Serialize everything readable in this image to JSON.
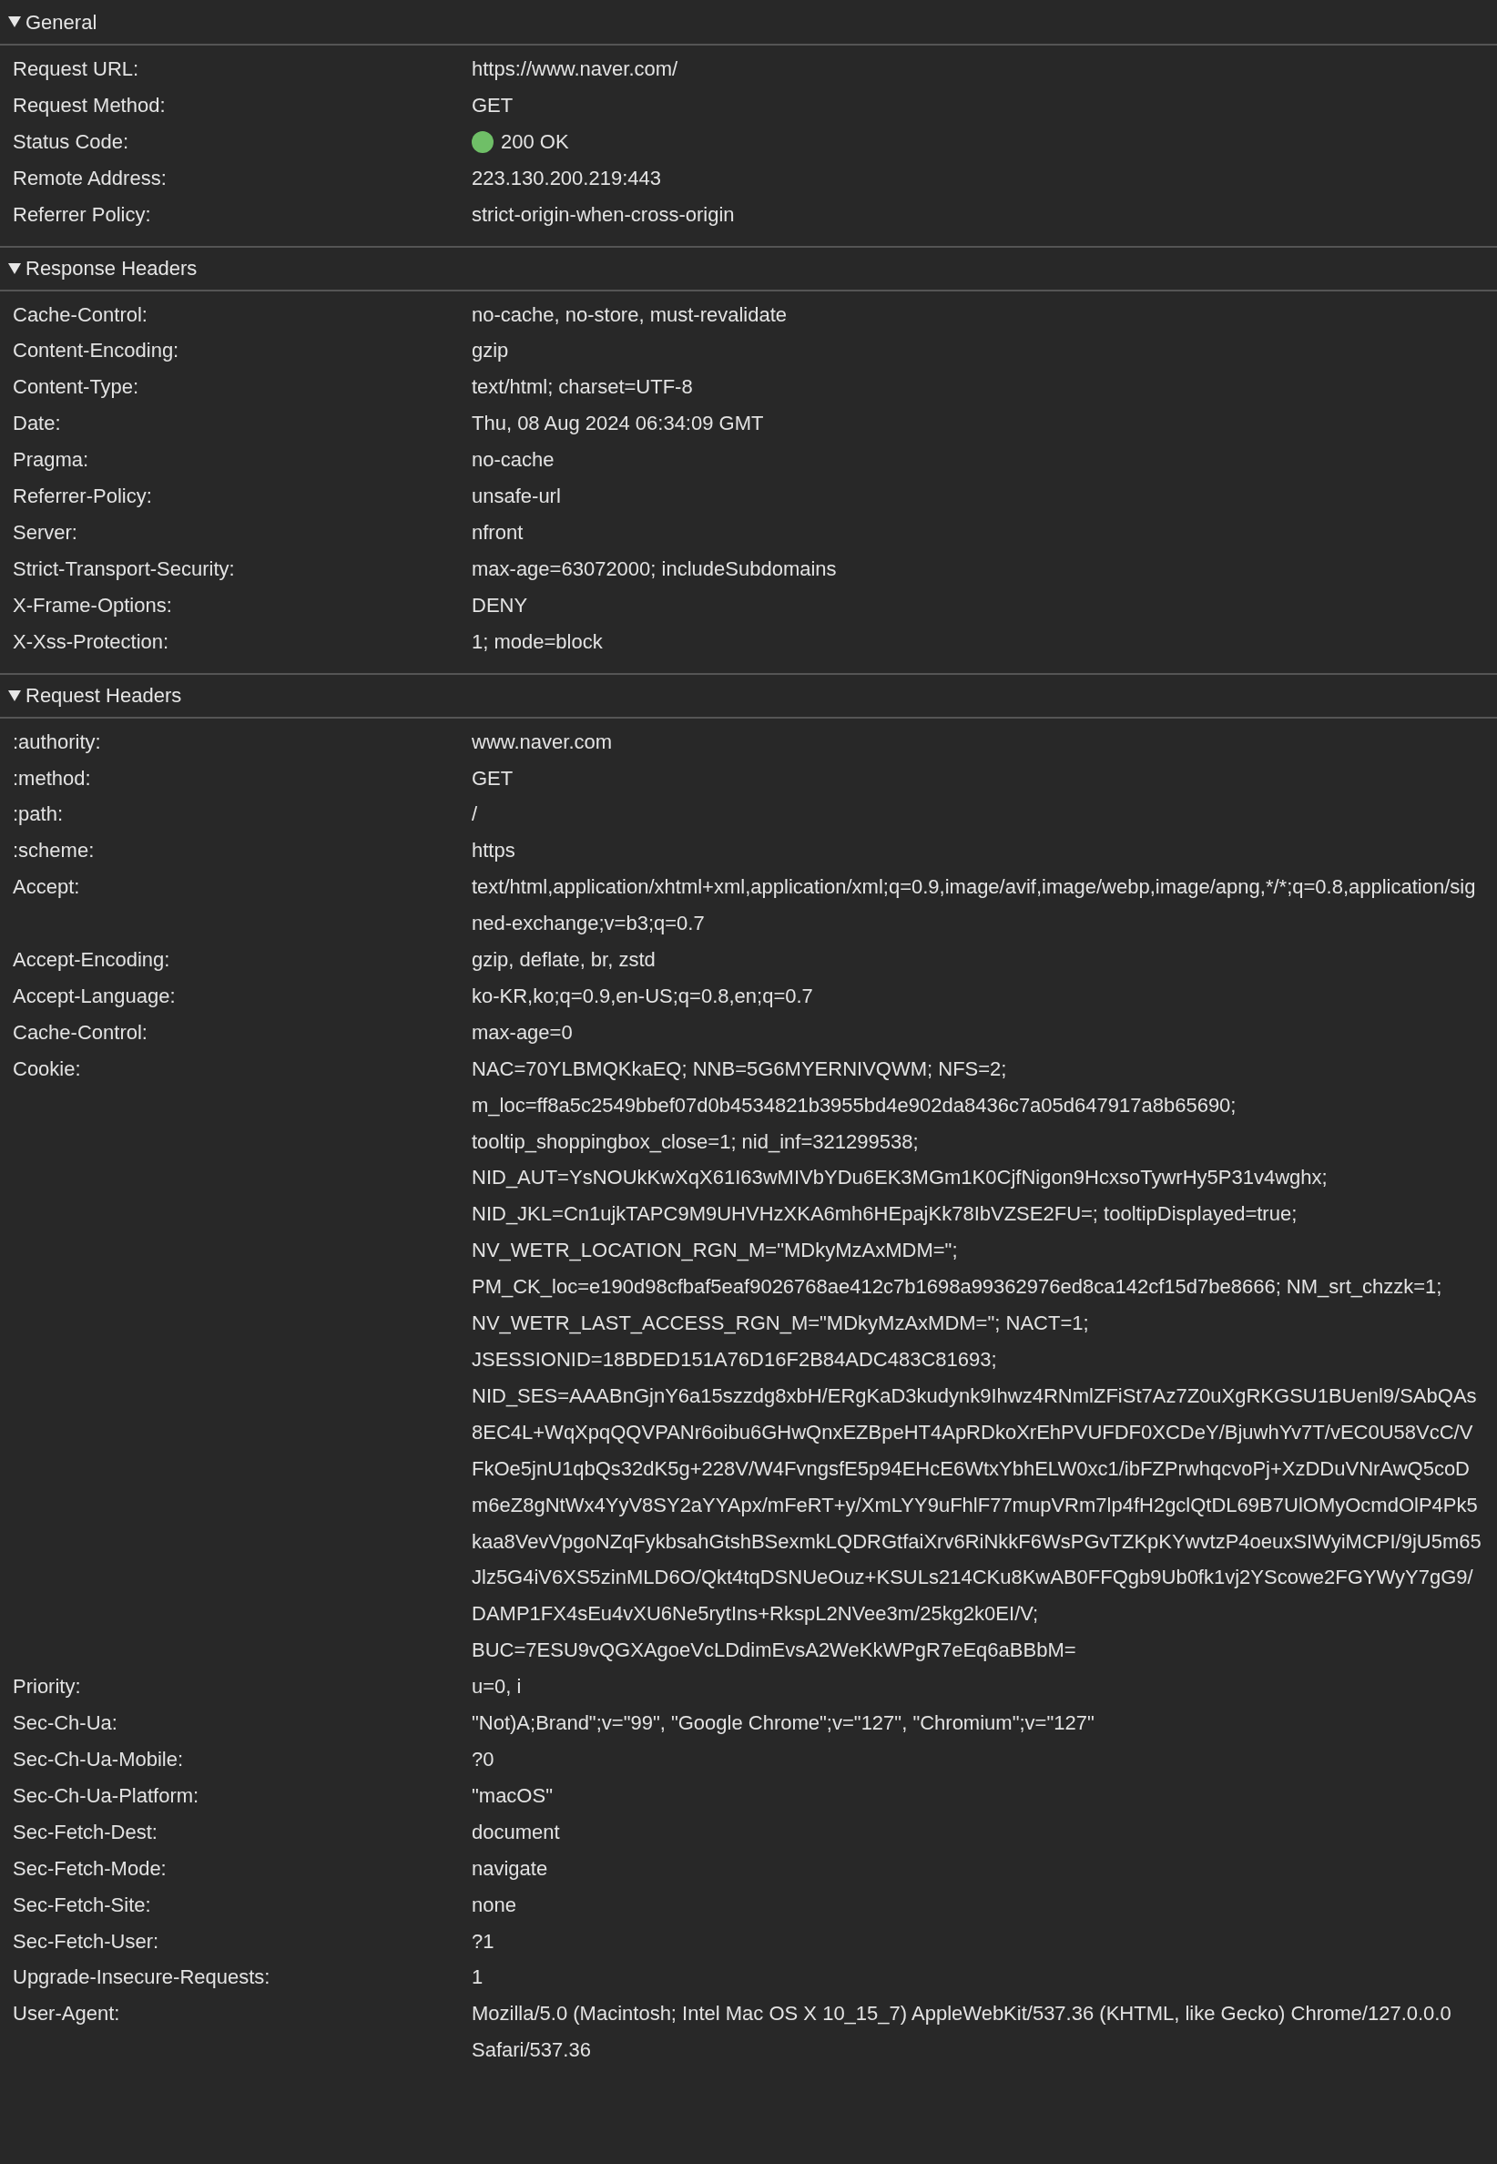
{
  "sections": [
    {
      "title": "General",
      "expanded": true,
      "rows": [
        {
          "name": "Request URL:",
          "value": "https://www.naver.com/"
        },
        {
          "name": "Request Method:",
          "value": "GET"
        },
        {
          "name": "Status Code:",
          "value": "200 OK",
          "color": "#6fbf67"
        },
        {
          "name": "Remote Address:",
          "value": "223.130.200.219:443"
        },
        {
          "name": "Referrer Policy:",
          "value": "strict-origin-when-cross-origin"
        }
      ]
    },
    {
      "title": "Response Headers",
      "expanded": true,
      "rows": [
        {
          "name": "Cache-Control:",
          "value": "no-cache, no-store, must-revalidate"
        },
        {
          "name": "Content-Encoding:",
          "value": "gzip"
        },
        {
          "name": "Content-Type:",
          "value": "text/html; charset=UTF-8"
        },
        {
          "name": "Date:",
          "value": "Thu, 08 Aug 2024 06:34:09 GMT"
        },
        {
          "name": "Pragma:",
          "value": "no-cache"
        },
        {
          "name": "Referrer-Policy:",
          "value": "unsafe-url"
        },
        {
          "name": "Server:",
          "value": "nfront"
        },
        {
          "name": "Strict-Transport-Security:",
          "value": "max-age=63072000; includeSubdomains"
        },
        {
          "name": "X-Frame-Options:",
          "value": "DENY"
        },
        {
          "name": "X-Xss-Protection:",
          "value": "1; mode=block"
        }
      ]
    },
    {
      "title": "Request Headers",
      "expanded": true,
      "rows": [
        {
          "name": ":authority:",
          "value": "www.naver.com"
        },
        {
          "name": ":method:",
          "value": "GET"
        },
        {
          "name": ":path:",
          "value": "/"
        },
        {
          "name": ":scheme:",
          "value": "https"
        },
        {
          "name": "Accept:",
          "value": "text/html,application/xhtml+xml,application/xml;q=0.9,image/avif,image/webp,image/apng,*/*;q=0.8,application/signed-exchange;v=b3;q=0.7"
        },
        {
          "name": "Accept-Encoding:",
          "value": "gzip, deflate, br, zstd"
        },
        {
          "name": "Accept-Language:",
          "value": "ko-KR,ko;q=0.9,en-US;q=0.8,en;q=0.7"
        },
        {
          "name": "Cache-Control:",
          "value": "max-age=0"
        },
        {
          "name": "Cookie:",
          "value": "NAC=70YLBMQKkaEQ; NNB=5G6MYERNIVQWM; NFS=2; m_loc=ff8a5c2549bbef07d0b4534821b3955bd4e902da8436c7a05d647917a8b65690; tooltip_shoppingbox_close=1; nid_inf=321299538; NID_AUT=YsNOUkKwXqX61I63wMIVbYDu6EK3MGm1K0CjfNigon9HcxsoTywrHy5P31v4wghx; NID_JKL=Cn1ujkTAPC9M9UHVHzXKA6mh6HEpajKk78IbVZSE2FU=; tooltipDisplayed=true; NV_WETR_LOCATION_RGN_M=\"MDkyMzAxMDM=\"; PM_CK_loc=e190d98cfbaf5eaf9026768ae412c7b1698a99362976ed8ca142cf15d7be8666; NM_srt_chzzk=1; NV_WETR_LAST_ACCESS_RGN_M=\"MDkyMzAxMDM=\"; NACT=1; JSESSIONID=18BDED151A76D16F2B84ADC483C81693; NID_SES=AAABnGjnY6a15szzdg8xbH/ERgKaD3kudynk9Ihwz4RNmlZFiSt7Az7Z0uXgRKGSU1BUenl9/SAbQAs8EC4L+WqXpqQQVPANr6oibu6GHwQnxEZBpeHT4ApRDkoXrEhPVUFDF0XCDeY/BjuwhYv7T/vEC0U58VcC/VFkOe5jnU1qbQs32dK5g+228V/W4FvngsfE5p94EHcE6WtxYbhELW0xc1/ibFZPrwhqcvoPj+XzDDuVNrAwQ5coDm6eZ8gNtWx4YyV8SY2aYYApx/mFeRT+y/XmLYY9uFhlF77mupVRm7lp4fH2gclQtDL69B7UlOMyOcmdOlP4Pk5kaa8VevVpgoNZqFykbsahGtshBSexmkLQDRGtfaiXrv6RiNkkF6WsPGvTZKpKYwvtzP4oeuxSIWyiMCPI/9jU5m65Jlz5G4iV6XS5zinMLD6O/Qkt4tqDSNUeOuz+KSULs214CKu8KwAB0FFQgb9Ub0fk1vj2YScowe2FGYWyY7gG9/DAMP1FX4sEu4vXU6Ne5rytIns+RkspL2NVee3m/25kg2k0EI/V; BUC=7ESU9vQGXAgoeVcLDdimEvsA2WeKkWPgR7eEq6aBBbM="
        },
        {
          "name": "Priority:",
          "value": "u=0, i"
        },
        {
          "name": "Sec-Ch-Ua:",
          "value": "\"Not)A;Brand\";v=\"99\", \"Google Chrome\";v=\"127\", \"Chromium\";v=\"127\""
        },
        {
          "name": "Sec-Ch-Ua-Mobile:",
          "value": "?0"
        },
        {
          "name": "Sec-Ch-Ua-Platform:",
          "value": "\"macOS\""
        },
        {
          "name": "Sec-Fetch-Dest:",
          "value": "document"
        },
        {
          "name": "Sec-Fetch-Mode:",
          "value": "navigate"
        },
        {
          "name": "Sec-Fetch-Site:",
          "value": "none"
        },
        {
          "name": "Sec-Fetch-User:",
          "value": "?1"
        },
        {
          "name": "Upgrade-Insecure-Requests:",
          "value": "1"
        },
        {
          "name": "User-Agent:",
          "value": "Mozilla/5.0 (Macintosh; Intel Mac OS X 10_15_7) AppleWebKit/537.36 (KHTML, like Gecko) Chrome/127.0.0.0 Safari/537.36"
        }
      ]
    }
  ]
}
